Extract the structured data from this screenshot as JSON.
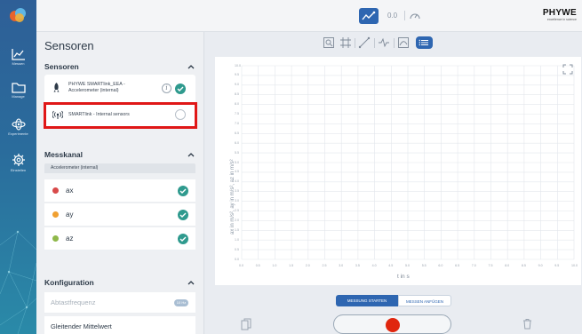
{
  "app": {
    "brand_name": "PHYWE",
    "brand_tagline": "excellence in science",
    "accent_color": "#2e66b1",
    "record_color": "#e0260e"
  },
  "rail": {
    "items": [
      {
        "label": "Messen",
        "icon": "chart-icon"
      },
      {
        "label": "Manage",
        "icon": "folder-icon"
      },
      {
        "label": "Experimente",
        "icon": "atom-icon"
      },
      {
        "label": "Einstellen",
        "icon": "gear-icon"
      }
    ]
  },
  "topbar": {
    "value": "0.0",
    "mode_icon": "graph-icon",
    "gauge_icon": "gauge-icon"
  },
  "sidebar": {
    "title": "Sensoren",
    "sensors_section": "Sensoren",
    "sensors": [
      {
        "line1": "PHYWE SMARTlink_EEA -",
        "line2": "Accelerometer (internal)",
        "checked": true
      },
      {
        "line1": "SMARTlink - Internal sensors",
        "line2": "",
        "checked": false
      }
    ],
    "channel_section": "Messkanal",
    "channel_group": "Accelerometer (internal)",
    "channels": [
      {
        "name": "ax",
        "color": "#d84a4a"
      },
      {
        "name": "ay",
        "color": "#f0a031"
      },
      {
        "name": "az",
        "color": "#8fb84a"
      }
    ],
    "config_section": "Konfiguration",
    "config_items": [
      {
        "label": "Abtastfrequenz",
        "badge": "10 Hz",
        "disabled": true
      },
      {
        "label": "Gleitender Mittelwert",
        "badge": "",
        "disabled": false
      }
    ]
  },
  "plot": {
    "ylabel": "ax in m/s², ay in m/s², az in m/s²",
    "xlabel": "t in s",
    "y_ticks": [
      "10.0",
      "9.5",
      "9.0",
      "8.5",
      "8.0",
      "7.5",
      "7.0",
      "6.5",
      "6.0",
      "5.5",
      "5.0",
      "4.5",
      "4.0",
      "3.5",
      "3.0",
      "2.5",
      "2.0",
      "1.5",
      "1.0",
      "0.5",
      "0.0"
    ],
    "x_ticks": [
      "0.0",
      "0.5",
      "1.0",
      "1.5",
      "2.0",
      "2.5",
      "3.0",
      "3.5",
      "4.0",
      "4.5",
      "5.0",
      "5.5",
      "6.0",
      "6.5",
      "7.0",
      "7.5",
      "8.0",
      "8.5",
      "9.0",
      "9.5",
      "10.0"
    ]
  },
  "controls": {
    "start_label": "MESSUNG STARTEN",
    "append_label": "MESSEN ANFÜGEN"
  }
}
